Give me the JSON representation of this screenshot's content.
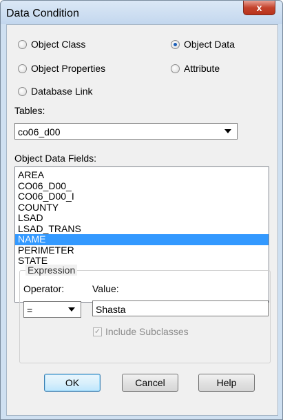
{
  "window": {
    "title": "Data Condition",
    "close_glyph": "x"
  },
  "radios": {
    "object_class": {
      "label": "Object Class",
      "checked": false
    },
    "object_data": {
      "label": "Object Data",
      "checked": true
    },
    "object_properties": {
      "label": "Object Properties",
      "checked": false
    },
    "attribute": {
      "label": "Attribute",
      "checked": false
    },
    "database_link": {
      "label": "Database Link",
      "checked": false
    }
  },
  "tables": {
    "label": "Tables:",
    "value": "co06_d00"
  },
  "fields": {
    "label": "Object Data Fields:",
    "items": [
      "AREA",
      "CO06_D00_",
      "CO06_D00_I",
      "COUNTY",
      "LSAD",
      "LSAD_TRANS",
      "NAME",
      "PERIMETER",
      "STATE"
    ],
    "selected": "NAME"
  },
  "expression": {
    "title": "Expression",
    "operator_label": "Operator:",
    "operator_value": "=",
    "value_label": "Value:",
    "value": "Shasta",
    "include_subclasses": "Include Subclasses"
  },
  "buttons": {
    "ok": "OK",
    "cancel": "Cancel",
    "help": "Help"
  }
}
